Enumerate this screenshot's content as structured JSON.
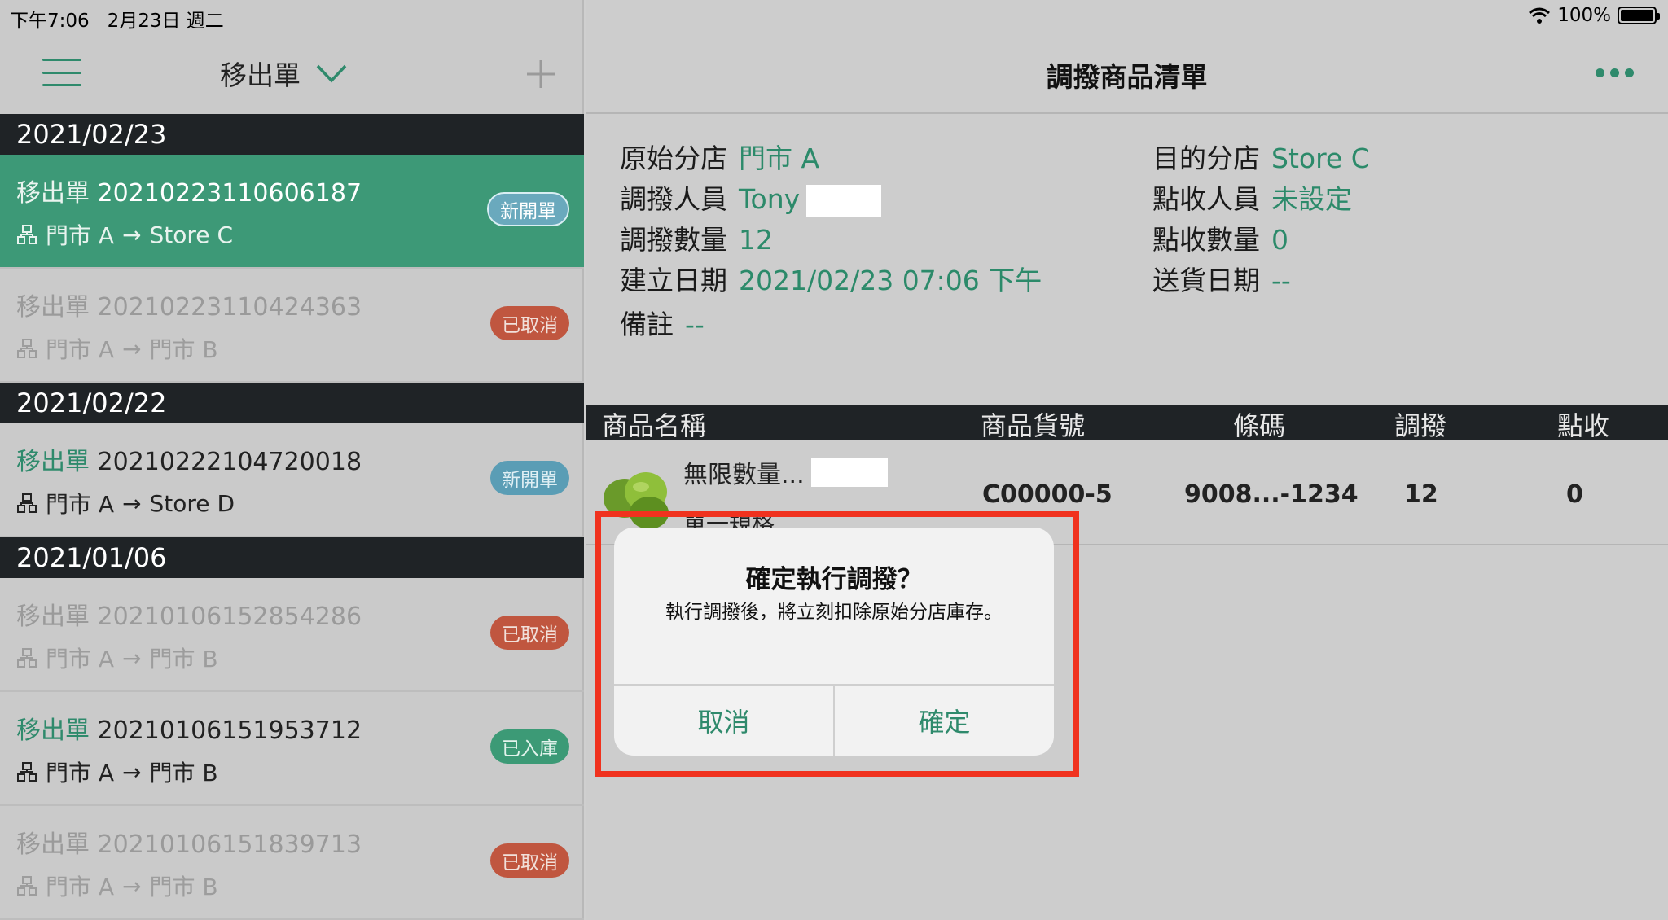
{
  "status": {
    "time": "下午7:06",
    "date": "2月23日 週二",
    "battery": "100%"
  },
  "left": {
    "title": "移出單",
    "groups": [
      {
        "date": "2021/02/23"
      },
      {
        "date": "2021/02/22"
      },
      {
        "date": "2021/01/06"
      }
    ],
    "orders": [
      {
        "type": "移出單",
        "number": "20210223110606187",
        "from": "門市 A",
        "to": "Store C",
        "badge": "新開單",
        "state": "active"
      },
      {
        "type": "移出單",
        "number": "20210223110424363",
        "from": "門市 A",
        "to": "門市 B",
        "badge": "已取消",
        "state": "cancelled"
      },
      {
        "type": "移出單",
        "number": "20210222104720018",
        "from": "門市 A",
        "to": "Store D",
        "badge": "新開單",
        "state": "new"
      },
      {
        "type": "移出單",
        "number": "20210106152854286",
        "from": "門市 A",
        "to": "門市 B",
        "badge": "已取消",
        "state": "cancelled"
      },
      {
        "type": "移出單",
        "number": "20210106151953712",
        "from": "門市 A",
        "to": "門市 B",
        "badge": "已入庫",
        "state": "stocked"
      },
      {
        "type": "移出單",
        "number": "20210106151839713",
        "from": "門市 A",
        "to": "門市 B",
        "badge": "已取消",
        "state": "cancelled"
      }
    ],
    "arrow": "→"
  },
  "right": {
    "title": "調撥商品清單",
    "info": {
      "source_label": "原始分店",
      "source_value": "門市 A",
      "dest_label": "目的分店",
      "dest_value": "Store C",
      "staff_label": "調撥人員",
      "staff_value": "Tony",
      "receiver_label": "點收人員",
      "receiver_value": "未設定",
      "qty_label": "調撥數量",
      "qty_value": "12",
      "recv_qty_label": "點收數量",
      "recv_qty_value": "0",
      "created_label": "建立日期",
      "created_value": "2021/02/23 07:06 下午",
      "delivery_label": "送貨日期",
      "delivery_value": "--",
      "note_label": "備註",
      "note_value": "--"
    },
    "table": {
      "headers": {
        "name": "商品名稱",
        "sku": "商品貨號",
        "barcode": "條碼",
        "transfer": "調撥",
        "received": "點收"
      },
      "rows": [
        {
          "name": "無限數量...",
          "spec": "單一規格",
          "sku": "C00000-5",
          "barcode": "9008...-1234",
          "transfer": "12",
          "received": "0"
        }
      ]
    }
  },
  "dialog": {
    "title": "確定執行調撥？",
    "message": "執行調撥後，將立刻扣除原始分店庫存。",
    "cancel": "取消",
    "confirm": "確定"
  },
  "colors": {
    "accent": "#2f8a6c",
    "cancelled": "#c0563f",
    "highlight": "#f0321e"
  }
}
